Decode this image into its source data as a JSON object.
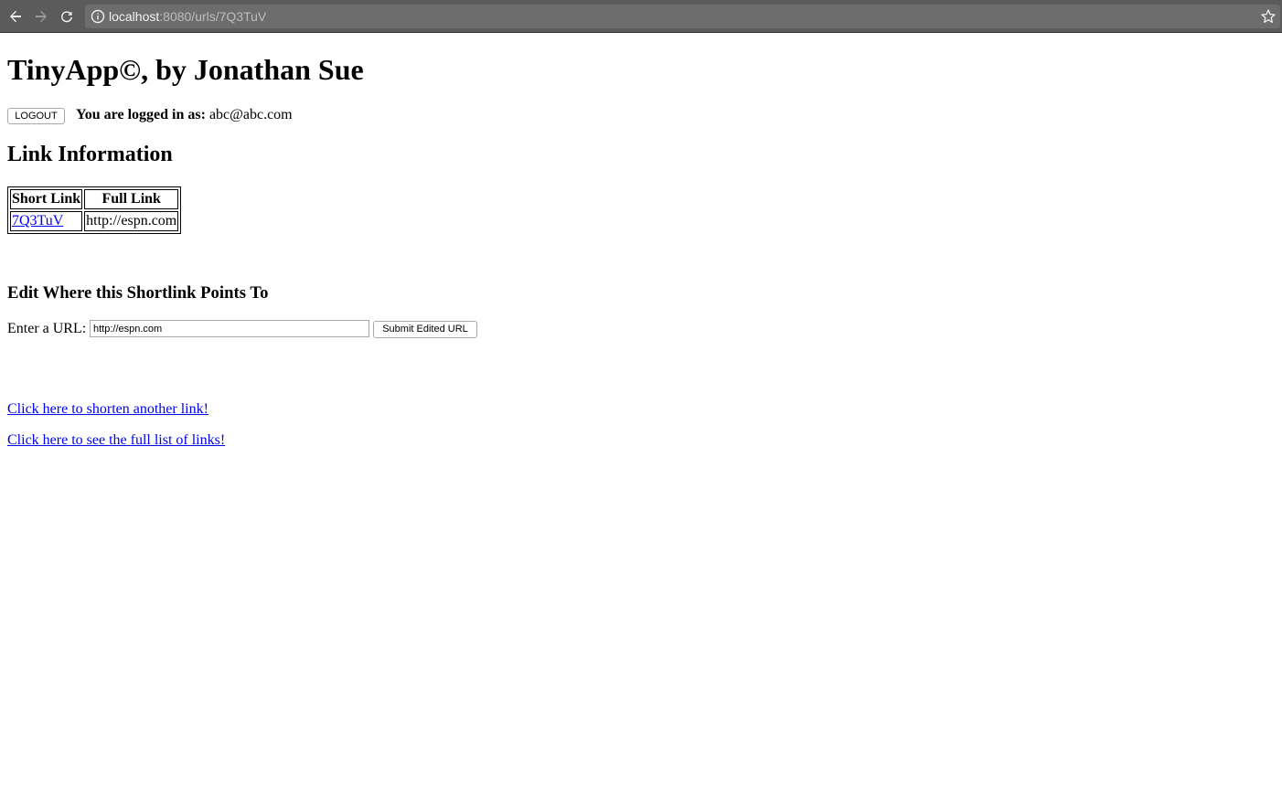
{
  "browser": {
    "url_host": "localhost",
    "url_path": ":8080/urls/7Q3TuV",
    "icons": [
      "back-arrow-icon",
      "forward-arrow-icon",
      "reload-icon",
      "info-icon",
      "star-icon"
    ]
  },
  "header": {
    "title": "TinyApp©, by Jonathan Sue",
    "logout_label": "LOGOUT",
    "login_prefix": "You are logged in as:",
    "user_email": "abc@abc.com"
  },
  "link_info": {
    "heading": "Link Information",
    "columns": [
      "Short Link",
      "Full Link"
    ],
    "rows": [
      {
        "short": "7Q3TuV",
        "full": "http://espn.com"
      }
    ]
  },
  "edit": {
    "heading": "Edit Where this Shortlink Points To",
    "label": "Enter a URL:",
    "input_value": "http://espn.com",
    "submit_label": "Submit Edited URL"
  },
  "links": {
    "shorten_another": "Click here to shorten another link!",
    "full_list": "Click here to see the full list of links!"
  }
}
